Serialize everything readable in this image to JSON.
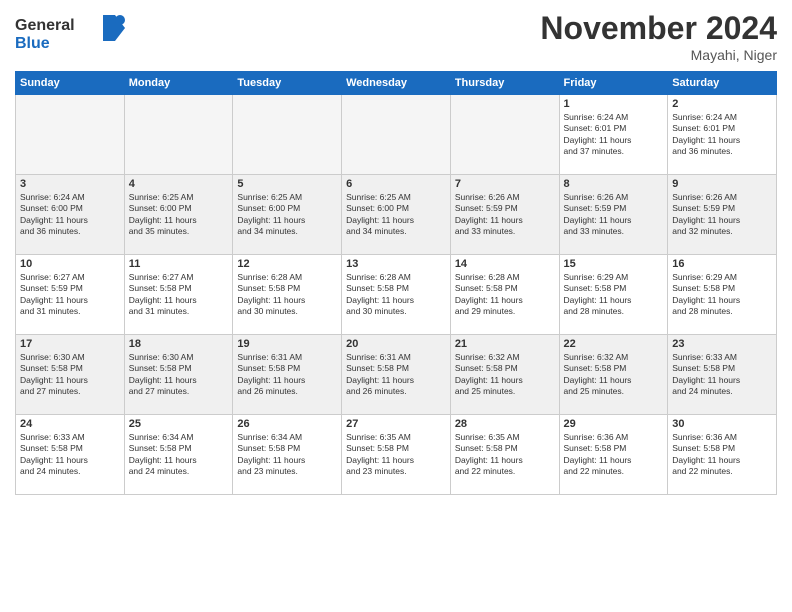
{
  "logo": {
    "line1": "General",
    "line2": "Blue"
  },
  "title": "November 2024",
  "location": "Mayahi, Niger",
  "days_of_week": [
    "Sunday",
    "Monday",
    "Tuesday",
    "Wednesday",
    "Thursday",
    "Friday",
    "Saturday"
  ],
  "weeks": [
    [
      {
        "day": "",
        "info": "",
        "empty": true
      },
      {
        "day": "",
        "info": "",
        "empty": true
      },
      {
        "day": "",
        "info": "",
        "empty": true
      },
      {
        "day": "",
        "info": "",
        "empty": true
      },
      {
        "day": "",
        "info": "",
        "empty": true
      },
      {
        "day": "1",
        "info": "Sunrise: 6:24 AM\nSunset: 6:01 PM\nDaylight: 11 hours\nand 37 minutes."
      },
      {
        "day": "2",
        "info": "Sunrise: 6:24 AM\nSunset: 6:01 PM\nDaylight: 11 hours\nand 36 minutes."
      }
    ],
    [
      {
        "day": "3",
        "info": "Sunrise: 6:24 AM\nSunset: 6:00 PM\nDaylight: 11 hours\nand 36 minutes."
      },
      {
        "day": "4",
        "info": "Sunrise: 6:25 AM\nSunset: 6:00 PM\nDaylight: 11 hours\nand 35 minutes."
      },
      {
        "day": "5",
        "info": "Sunrise: 6:25 AM\nSunset: 6:00 PM\nDaylight: 11 hours\nand 34 minutes."
      },
      {
        "day": "6",
        "info": "Sunrise: 6:25 AM\nSunset: 6:00 PM\nDaylight: 11 hours\nand 34 minutes."
      },
      {
        "day": "7",
        "info": "Sunrise: 6:26 AM\nSunset: 5:59 PM\nDaylight: 11 hours\nand 33 minutes."
      },
      {
        "day": "8",
        "info": "Sunrise: 6:26 AM\nSunset: 5:59 PM\nDaylight: 11 hours\nand 33 minutes."
      },
      {
        "day": "9",
        "info": "Sunrise: 6:26 AM\nSunset: 5:59 PM\nDaylight: 11 hours\nand 32 minutes."
      }
    ],
    [
      {
        "day": "10",
        "info": "Sunrise: 6:27 AM\nSunset: 5:59 PM\nDaylight: 11 hours\nand 31 minutes."
      },
      {
        "day": "11",
        "info": "Sunrise: 6:27 AM\nSunset: 5:58 PM\nDaylight: 11 hours\nand 31 minutes."
      },
      {
        "day": "12",
        "info": "Sunrise: 6:28 AM\nSunset: 5:58 PM\nDaylight: 11 hours\nand 30 minutes."
      },
      {
        "day": "13",
        "info": "Sunrise: 6:28 AM\nSunset: 5:58 PM\nDaylight: 11 hours\nand 30 minutes."
      },
      {
        "day": "14",
        "info": "Sunrise: 6:28 AM\nSunset: 5:58 PM\nDaylight: 11 hours\nand 29 minutes."
      },
      {
        "day": "15",
        "info": "Sunrise: 6:29 AM\nSunset: 5:58 PM\nDaylight: 11 hours\nand 28 minutes."
      },
      {
        "day": "16",
        "info": "Sunrise: 6:29 AM\nSunset: 5:58 PM\nDaylight: 11 hours\nand 28 minutes."
      }
    ],
    [
      {
        "day": "17",
        "info": "Sunrise: 6:30 AM\nSunset: 5:58 PM\nDaylight: 11 hours\nand 27 minutes."
      },
      {
        "day": "18",
        "info": "Sunrise: 6:30 AM\nSunset: 5:58 PM\nDaylight: 11 hours\nand 27 minutes."
      },
      {
        "day": "19",
        "info": "Sunrise: 6:31 AM\nSunset: 5:58 PM\nDaylight: 11 hours\nand 26 minutes."
      },
      {
        "day": "20",
        "info": "Sunrise: 6:31 AM\nSunset: 5:58 PM\nDaylight: 11 hours\nand 26 minutes."
      },
      {
        "day": "21",
        "info": "Sunrise: 6:32 AM\nSunset: 5:58 PM\nDaylight: 11 hours\nand 25 minutes."
      },
      {
        "day": "22",
        "info": "Sunrise: 6:32 AM\nSunset: 5:58 PM\nDaylight: 11 hours\nand 25 minutes."
      },
      {
        "day": "23",
        "info": "Sunrise: 6:33 AM\nSunset: 5:58 PM\nDaylight: 11 hours\nand 24 minutes."
      }
    ],
    [
      {
        "day": "24",
        "info": "Sunrise: 6:33 AM\nSunset: 5:58 PM\nDaylight: 11 hours\nand 24 minutes."
      },
      {
        "day": "25",
        "info": "Sunrise: 6:34 AM\nSunset: 5:58 PM\nDaylight: 11 hours\nand 24 minutes."
      },
      {
        "day": "26",
        "info": "Sunrise: 6:34 AM\nSunset: 5:58 PM\nDaylight: 11 hours\nand 23 minutes."
      },
      {
        "day": "27",
        "info": "Sunrise: 6:35 AM\nSunset: 5:58 PM\nDaylight: 11 hours\nand 23 minutes."
      },
      {
        "day": "28",
        "info": "Sunrise: 6:35 AM\nSunset: 5:58 PM\nDaylight: 11 hours\nand 22 minutes."
      },
      {
        "day": "29",
        "info": "Sunrise: 6:36 AM\nSunset: 5:58 PM\nDaylight: 11 hours\nand 22 minutes."
      },
      {
        "day": "30",
        "info": "Sunrise: 6:36 AM\nSunset: 5:58 PM\nDaylight: 11 hours\nand 22 minutes."
      }
    ]
  ]
}
